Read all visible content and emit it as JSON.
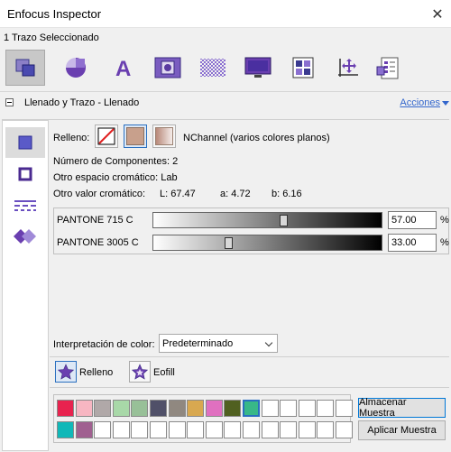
{
  "window": {
    "title": "Enfocus Inspector",
    "close_glyph": "✕"
  },
  "selection_text": "1 Trazo Seleccionado",
  "toolbar": {
    "tools": [
      "fill-stroke-icon",
      "shape-icon",
      "text-icon",
      "image-icon",
      "transparency-icon",
      "display-icon",
      "layout-grid-icon",
      "coordinates-icon",
      "document-icon"
    ],
    "active": 0
  },
  "section": {
    "title": "Llenado y Trazo - Llenado",
    "actions": "Acciones"
  },
  "left_tabs": [
    "fill-square-icon",
    "stroke-square-icon",
    "dashes-icon",
    "overprint-icon"
  ],
  "fill": {
    "label": "Relleno:",
    "color_space": "NChannel (varios colores planos)",
    "components": "Número de Componentes: 2",
    "alt_space": "Otro espacio cromático: Lab",
    "alt_value_label": "Otro valor cromático:",
    "lab": {
      "L": "L:  67.47",
      "a": "a:  4.72",
      "b": "b:  6.16"
    }
  },
  "inks": [
    {
      "name": "PANTONE 715 C",
      "value": "57.00",
      "unit": "%",
      "level": 0.57
    },
    {
      "name": "PANTONE 3005 C",
      "value": "33.00",
      "unit": "%",
      "level": 0.33
    }
  ],
  "interpretation": {
    "label": "Interpretación de color:",
    "value": "Predeterminado"
  },
  "fill_rules": {
    "fill": "Relleno",
    "eofill": "Eofill"
  },
  "swatches": {
    "row1": [
      "#e8234f",
      "#f7b6c2",
      "#b0a8a8",
      "#a8d8a8",
      "#98c098",
      "#505068",
      "#908880",
      "#d8a850",
      "#e070c0",
      "#506020",
      "#38b888",
      "",
      "",
      "",
      "",
      ""
    ],
    "row2": [
      "#10b8b8",
      "#a06090",
      "",
      "",
      "",
      "",
      "",
      "",
      "",
      "",
      "",
      "",
      "",
      "",
      "",
      ""
    ],
    "selected_index": 10
  },
  "buttons": {
    "store": "Almacenar Muestra",
    "apply": "Aplicar Muestra"
  }
}
